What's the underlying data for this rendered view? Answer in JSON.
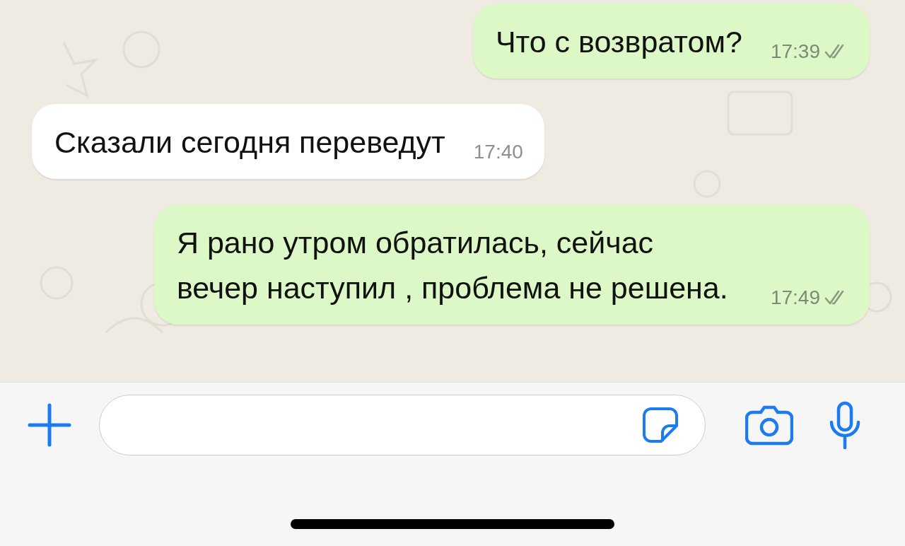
{
  "messages": [
    {
      "kind": "outgoing",
      "text": "Что с возвратом?",
      "time": "17:39",
      "read": false
    },
    {
      "kind": "incoming",
      "text": "Сказали сегодня переведут",
      "time": "17:40"
    },
    {
      "kind": "outgoing",
      "text": "Я рано утром обратилась, сейчас вечер наступил , проблема не решена.",
      "time": "17:49",
      "read": false
    }
  ]
}
